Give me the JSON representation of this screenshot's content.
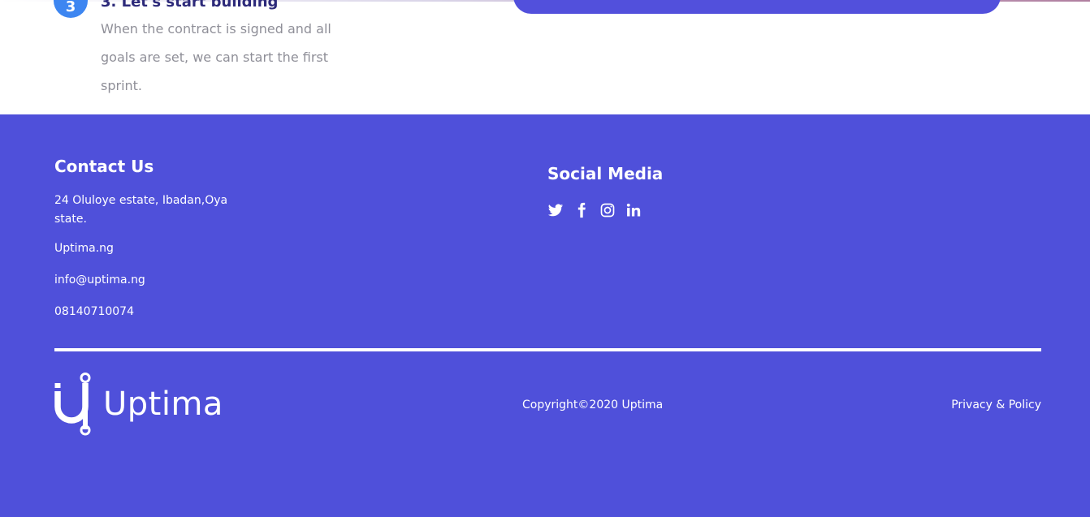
{
  "process_step": {
    "number": "3",
    "title": "3. Let's start building",
    "description": "When the contract is signed and all goals are set, we can start the first sprint."
  },
  "footer": {
    "contact": {
      "title": "Contact Us",
      "address": "24 Oluloye estate, Ibadan,Oya state.",
      "website": "Uptima.ng",
      "email": "info@uptima.ng",
      "phone": "08140710074"
    },
    "social": {
      "title": "Social Media",
      "icons": [
        "twitter-icon",
        "facebook-icon",
        "instagram-icon",
        "linkedin-icon"
      ]
    },
    "brand": {
      "name": "Uptima"
    },
    "copyright": "Copyright©2020 Uptima",
    "privacy_link": "Privacy & Policy"
  },
  "colors": {
    "footer_bg": "#4f50da",
    "accent_blue": "#3d86f1",
    "heading_dark": "#2d2a7a",
    "muted_text": "#8f8f98"
  }
}
